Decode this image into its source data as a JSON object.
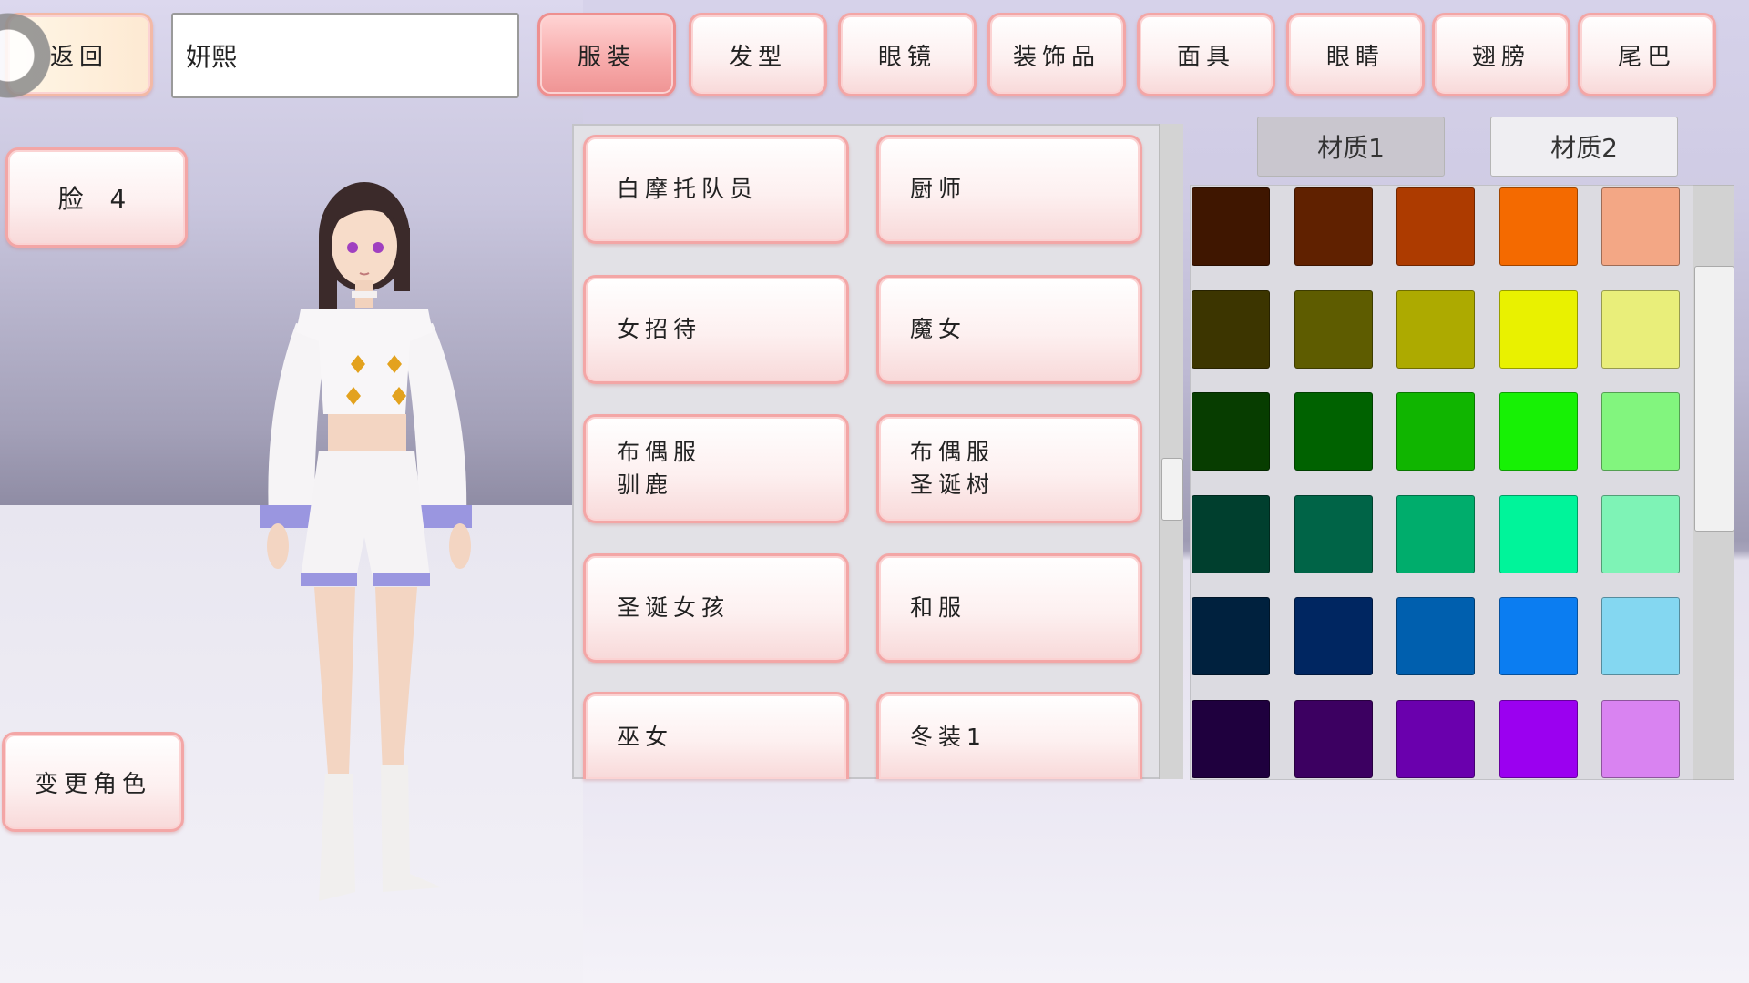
{
  "top_bar": {
    "back_label": "返回",
    "name_value": "妍熙",
    "tabs": [
      {
        "label": "服装",
        "active": true
      },
      {
        "label": "发型",
        "active": false
      },
      {
        "label": "眼镜",
        "active": false
      },
      {
        "label": "装饰品",
        "active": false
      },
      {
        "label": "面具",
        "active": false
      },
      {
        "label": "眼睛",
        "active": false
      },
      {
        "label": "翅膀",
        "active": false
      },
      {
        "label": "尾巴",
        "active": false
      }
    ]
  },
  "left_panel": {
    "face_label": "脸 4",
    "change_character_label": "变更角色"
  },
  "outfit_list": {
    "items": [
      {
        "line1": "白摩托队员",
        "line2": ""
      },
      {
        "line1": "厨师",
        "line2": ""
      },
      {
        "line1": "女招待",
        "line2": ""
      },
      {
        "line1": "魔女",
        "line2": ""
      },
      {
        "line1": "布偶服",
        "line2": "驯鹿"
      },
      {
        "line1": "布偶服",
        "line2": "圣诞树"
      },
      {
        "line1": "圣诞女孩",
        "line2": ""
      },
      {
        "line1": "和服",
        "line2": ""
      },
      {
        "line1": "巫女",
        "line2": ""
      },
      {
        "line1": "冬装1",
        "line2": ""
      }
    ]
  },
  "material_tabs": [
    {
      "label": "材质1",
      "selected": true
    },
    {
      "label": "材质2",
      "selected": false
    }
  ],
  "palette": {
    "rows": [
      [
        "#3f1600",
        "#602100",
        "#ad3b00",
        "#f46a00",
        "#f3a785"
      ],
      [
        "#3c3500",
        "#5e5c00",
        "#adaa00",
        "#e9f100",
        "#e9ee7a"
      ],
      [
        "#073d00",
        "#006200",
        "#10b500",
        "#17f105",
        "#82f57e"
      ],
      [
        "#003f2e",
        "#006447",
        "#00ad6c",
        "#00f49a",
        "#7ef3b6"
      ],
      [
        "#00213e",
        "#002661",
        "#005fae",
        "#0b7df1",
        "#84d7f1"
      ],
      [
        "#1f003e",
        "#3c0061",
        "#6a00ad",
        "#9b00f0",
        "#d983f1"
      ]
    ]
  }
}
